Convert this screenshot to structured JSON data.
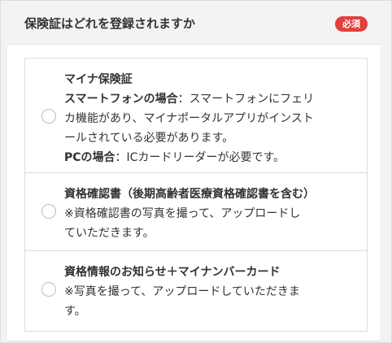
{
  "header": {
    "title": "保険証はどれを登録されますか",
    "badge": "必須",
    "badge_color": "#e0413c"
  },
  "options": [
    {
      "title": "マイナ保険証",
      "sp_label": "スマートフォンの場合",
      "sp_text_1": "：スマートフォンにフェリ",
      "sp_text_2": "カ機能があり、マイナポータルアプリがインスト",
      "sp_text_3": "ールされている必要があります。",
      "pc_label": "PCの場合",
      "pc_text": "：ICカードリーダーが必要です。"
    },
    {
      "title": "資格確認書（後期高齢者医療資格確認書を含む）",
      "text_1": "※資格確認書の写真を撮って、アップロードし",
      "text_2": "ていただきます。"
    },
    {
      "title": "資格情報のお知らせ＋マイナンバーカード",
      "text_1": "※写真を撮って、アップロードしていただきま",
      "text_2": "す。"
    }
  ]
}
